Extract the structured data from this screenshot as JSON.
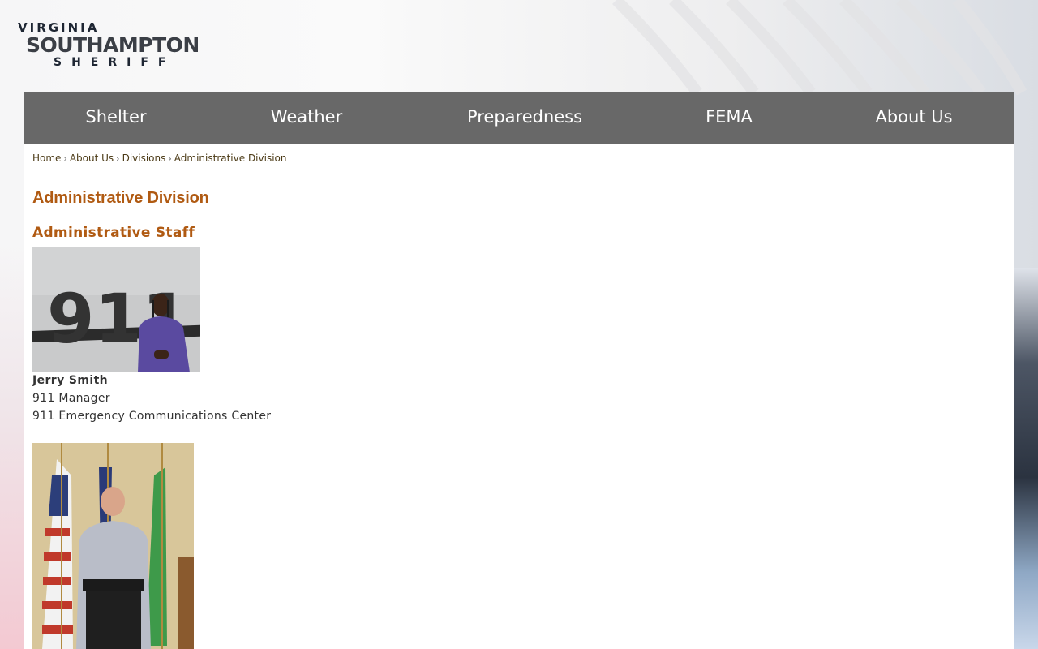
{
  "logo": {
    "top": "VIRGINIA",
    "main": "SOUTHAMPTON",
    "sub": "SHERIFF"
  },
  "nav": {
    "items": [
      {
        "label": "Shelter"
      },
      {
        "label": "Weather"
      },
      {
        "label": "Preparedness"
      },
      {
        "label": "FEMA"
      },
      {
        "label": "About Us"
      }
    ]
  },
  "breadcrumb": {
    "items": [
      "Home",
      "About Us",
      "Divisions",
      "Administrative Division"
    ],
    "separator": "›"
  },
  "page": {
    "title": "Administrative Division",
    "section_title": "Administrative Staff"
  },
  "staff": [
    {
      "name": "Jerry Smith",
      "title": "911 Manager",
      "unit": "911 Emergency Communications Center",
      "photo_text": "911"
    },
    {
      "name": "",
      "title": "",
      "unit": ""
    }
  ],
  "colors": {
    "nav_bg": "#686868",
    "heading": "#b05a12",
    "breadcrumb": "#4b3a16",
    "body_text": "#333333"
  }
}
